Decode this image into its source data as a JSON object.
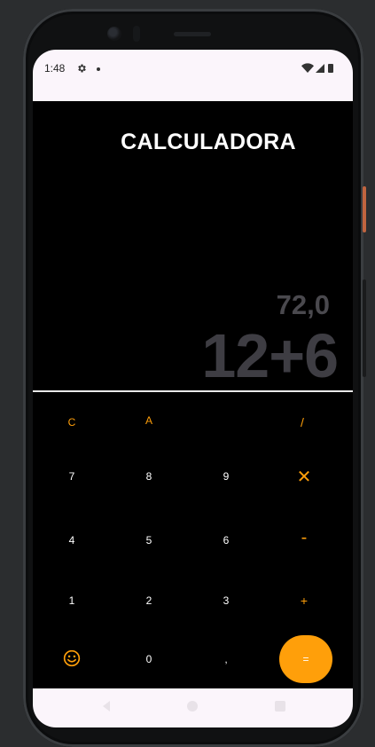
{
  "status_bar": {
    "time": "1:48",
    "icons": [
      "gear-icon",
      "notification-dot-icon",
      "wifi-icon",
      "signal-icon",
      "battery-icon"
    ]
  },
  "app": {
    "title": "CALCULADORA",
    "result": "72,0",
    "expression": "12+6"
  },
  "keypad": {
    "clear": "C",
    "all_clear": "A",
    "divide": "/",
    "seven": "7",
    "eight": "8",
    "nine": "9",
    "multiply": "✕",
    "four": "4",
    "five": "5",
    "six": "6",
    "subtract": "-",
    "one": "1",
    "two": "2",
    "three": "3",
    "add": "+",
    "emoji_icon": "smiley-icon",
    "zero": "0",
    "comma": ",",
    "equals": "="
  },
  "colors": {
    "accent": "#ff9f0a",
    "background": "#000000",
    "display_text": "#3e3d43",
    "system_bar": "#fbf5fb"
  },
  "nav_bar": {
    "icons": [
      "back-icon",
      "home-icon",
      "recents-icon"
    ]
  }
}
